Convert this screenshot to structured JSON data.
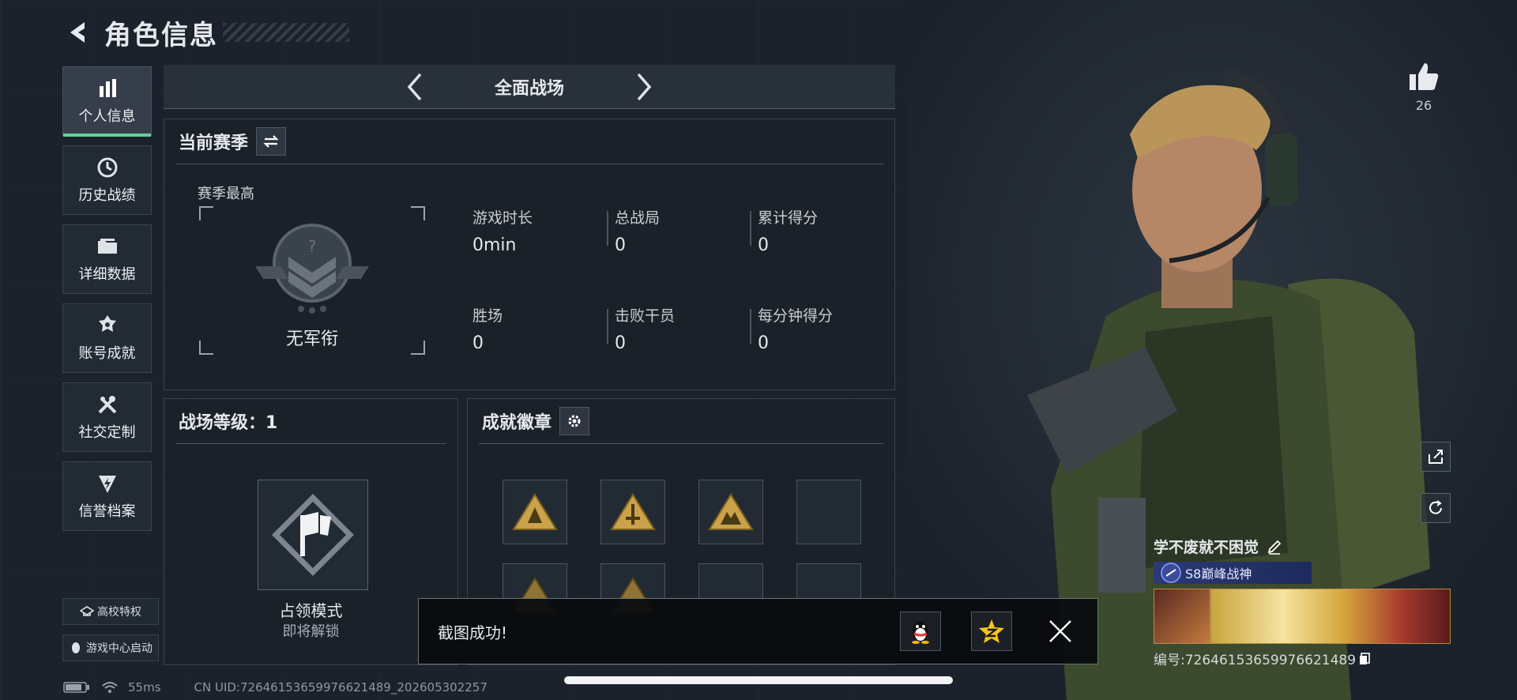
{
  "header": {
    "title": "角色信息"
  },
  "sidebar": {
    "items": [
      {
        "label": "个人信息",
        "icon": "bar-chart-icon",
        "active": true
      },
      {
        "label": "历史战绩",
        "icon": "history-clock-icon"
      },
      {
        "label": "详细数据",
        "icon": "folder-icon"
      },
      {
        "label": "账号成就",
        "icon": "achievement-icon"
      },
      {
        "label": "社交定制",
        "icon": "tools-icon"
      },
      {
        "label": "信誉档案",
        "icon": "credit-icon"
      }
    ],
    "campus_label": "高校特权",
    "game_center_label": "游戏中心启动"
  },
  "mode_bar": {
    "current": "全面战场"
  },
  "season": {
    "title": "当前赛季",
    "best_label": "赛季最高",
    "rank_name": "无军衔",
    "stats": [
      {
        "label": "游戏时长",
        "value": "0min"
      },
      {
        "label": "总战局",
        "value": "0"
      },
      {
        "label": "累计得分",
        "value": "0"
      },
      {
        "label": "胜场",
        "value": "0"
      },
      {
        "label": "击败干员",
        "value": "0"
      },
      {
        "label": "每分钟得分",
        "value": "0"
      }
    ]
  },
  "level": {
    "title": "战场等级：1",
    "mode_title": "占领模式",
    "mode_status": "即将解锁"
  },
  "badges": {
    "title": "成就徽章",
    "slots": 12
  },
  "character": {
    "likes": "26",
    "player_name": "学不废就不困觉",
    "rank_title": "S8巅峰战神",
    "player_id": "编号:7264615365997662148​9"
  },
  "toast": {
    "message": "截图成功!"
  },
  "status": {
    "ping": "55ms",
    "uid": "CN UID:7264615365997662148​9_202605302257"
  },
  "colors": {
    "accent_green": "#5fd39a",
    "rank_blue": "#2a3a78",
    "gold": "#c9a24a"
  }
}
